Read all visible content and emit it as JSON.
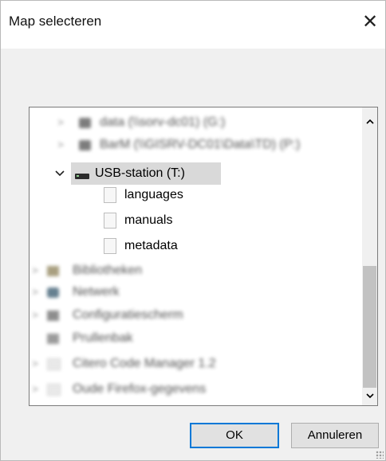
{
  "dialog": {
    "title": "Map selecteren",
    "close_glyph": "✕"
  },
  "tree": {
    "blurred_top": [
      {
        "label": "data (\\\\sorv-dc01) (G:)",
        "icon": "network-drive-icon"
      },
      {
        "label": "BarM (\\\\GISRV-DC01\\Data\\TD) (P:)",
        "icon": "network-drive-icon"
      }
    ],
    "selected_drive": {
      "label": "USB-station (T:)",
      "icon": "usb-drive-icon",
      "expanded": true
    },
    "folders": [
      "languages",
      "manuals",
      "metadata"
    ],
    "blurred_bottom": [
      {
        "label": "Bibliotheken",
        "icon": "libraries-icon"
      },
      {
        "label": "Netwerk",
        "icon": "network-icon"
      },
      {
        "label": "Configuratiescherm",
        "icon": "control-panel-icon"
      },
      {
        "label": "Prullenbak",
        "icon": "recycle-bin-icon"
      },
      {
        "label": "Citero Code Manager 1.2",
        "icon": "folder-icon"
      },
      {
        "label": "Oude Firefox-gegevens",
        "icon": "folder-icon"
      }
    ]
  },
  "buttons": {
    "ok": "OK",
    "cancel": "Annuleren"
  },
  "scrollbar": {
    "up": "^",
    "down": "v"
  },
  "colors": {
    "selection": "#d9d9d9",
    "accent": "#0078d7"
  }
}
